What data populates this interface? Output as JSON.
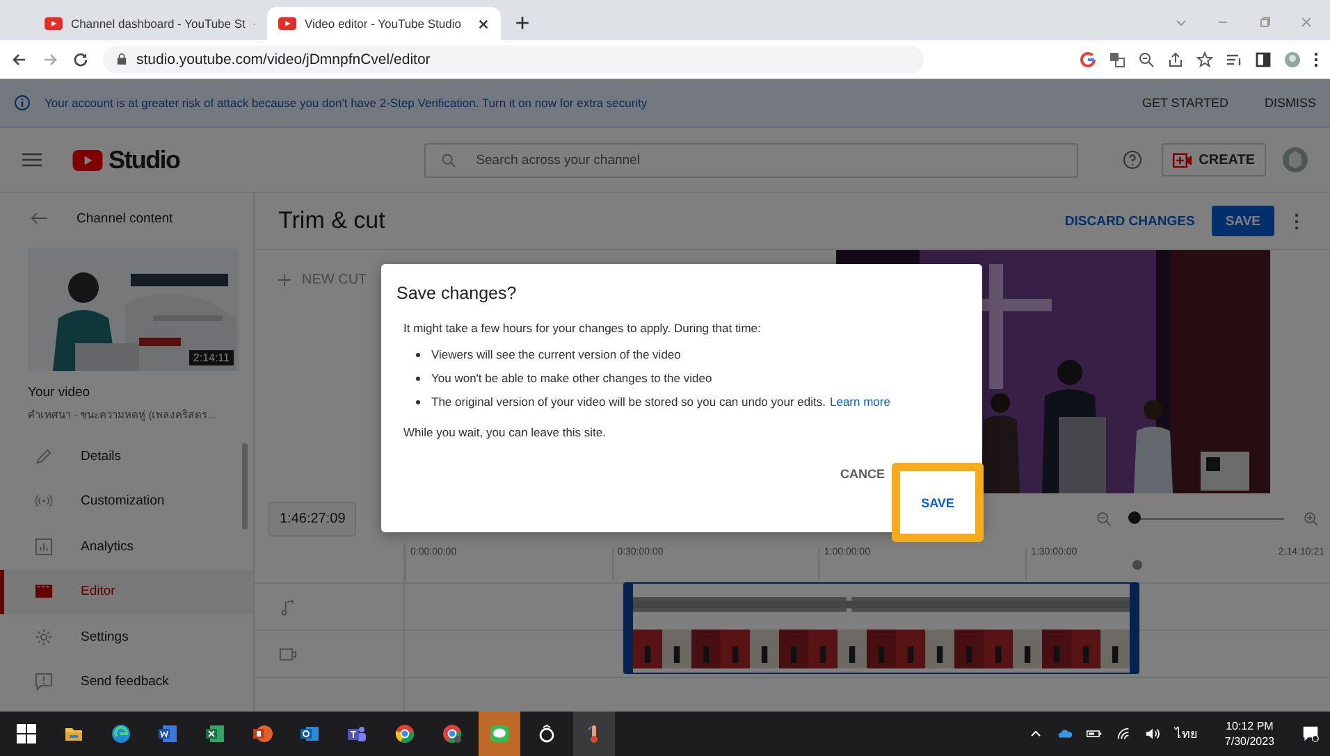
{
  "browser": {
    "tabs": [
      {
        "title": "Channel dashboard - YouTube St",
        "selected": false
      },
      {
        "title": "Video editor - YouTube Studio",
        "selected": true
      }
    ],
    "url": "studio.youtube.com/video/jDmnpfnCvel/editor"
  },
  "banner": {
    "message": "Your account is at greater risk of attack because you don't have 2-Step Verification. Turn it on now for extra security",
    "actions": [
      "GET STARTED",
      "DISMISS"
    ]
  },
  "header": {
    "logo": "Studio",
    "search": {
      "placeholder": "Search across your channel"
    },
    "create": "CREATE"
  },
  "sidebar": {
    "back": "Channel content",
    "duration": "2:14:11",
    "video_label": "Your video",
    "video_title": "คำเทศนา - ชนะความหดหู่ (เพลงคริสตร...",
    "items": [
      {
        "label": "Details",
        "selected": false
      },
      {
        "label": "Customization",
        "selected": false
      },
      {
        "label": "Analytics",
        "selected": false
      },
      {
        "label": "Editor",
        "selected": true
      },
      {
        "label": "Settings",
        "selected": false
      },
      {
        "label": "Send feedback",
        "selected": false
      }
    ]
  },
  "editor": {
    "title": "Trim & cut",
    "discard": "DISCARD CHANGES",
    "save": "SAVE",
    "new_cut": "NEW CUT",
    "timecode": "1:46:27:09",
    "zoom": {
      "level": 0
    },
    "ruler": [
      "0:00:00:00",
      "0:30:00:00",
      "1:00:00:00",
      "1:30:00:00",
      "2:14:10:21"
    ]
  },
  "dialog": {
    "title": "Save changes?",
    "intro": "It might take a few hours for your changes to apply. During that time:",
    "bullets": [
      "Viewers will see the current version of the video",
      "You won't be able to make other changes to the video",
      "The original version of your video will be stored so you can undo your edits."
    ],
    "link": "Learn more",
    "footer": "While you wait, you can leave this site.",
    "cancel": "CANCE",
    "save": "SAVE"
  },
  "taskbar": {
    "language": "ไทย",
    "time": "10:12 PM",
    "date": "7/30/2023"
  }
}
